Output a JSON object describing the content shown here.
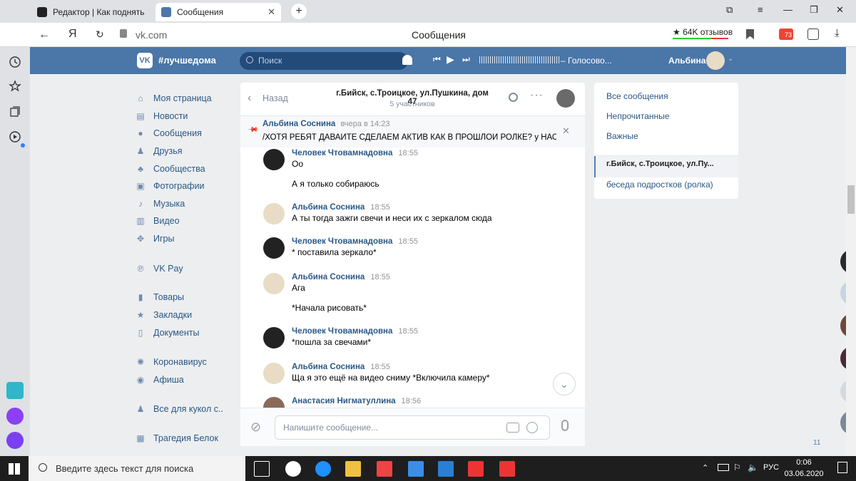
{
  "browser": {
    "tabs": [
      {
        "label": "Редактор | Как поднять ак"
      },
      {
        "label": "Сообщения"
      }
    ],
    "address": "vk.com",
    "page_title": "Сообщения",
    "reviews": "★ 64K отзывов",
    "badge": "73"
  },
  "vk": {
    "header": {
      "logo_text": "#лучшедома",
      "search_placeholder": "Поиск",
      "audio_title": "​– Голосово...",
      "user_name": "Альбина"
    },
    "left_nav": [
      {
        "label": "Моя страница",
        "icon": "home-icon"
      },
      {
        "label": "Новости",
        "icon": "news-icon"
      },
      {
        "label": "Сообщения",
        "icon": "messages-icon"
      },
      {
        "label": "Друзья",
        "icon": "friends-icon"
      },
      {
        "label": "Сообщества",
        "icon": "groups-icon"
      },
      {
        "label": "Фотографии",
        "icon": "photo-icon"
      },
      {
        "label": "Музыка",
        "icon": "music-icon"
      },
      {
        "label": "Видео",
        "icon": "video-icon"
      },
      {
        "label": "Игры",
        "icon": "games-icon"
      },
      {
        "label": "VK Pay",
        "icon": "vkpay-icon"
      },
      {
        "label": "Товары",
        "icon": "market-icon"
      },
      {
        "label": "Закладки",
        "icon": "bookmark-icon"
      },
      {
        "label": "Документы",
        "icon": "docs-icon"
      },
      {
        "label": "Коронавирус",
        "icon": "virus-icon"
      },
      {
        "label": "Афиша",
        "icon": "afisha-icon"
      },
      {
        "label": "Все для кукол с..",
        "icon": "group-icon"
      },
      {
        "label": "Трагедия Белок",
        "icon": "app-icon"
      }
    ],
    "chat": {
      "back_label": "Назад",
      "title": "г.Бийск, с.Троицкое, ул.Пушкина, дом 47",
      "participants": "5 участников",
      "pinned": {
        "author": "Альбина Соснина",
        "time": "вчера в 14:23",
        "text": "/ХОТЯ РЕБЯТ ДАВАЙТЕ СДЕЛАЕМ АКТИВ КАК В ПРОШЛОЙ РОЛКЕ? у НАС ..."
      },
      "messages": [
        {
          "author": "Человек Чтовамнадовна",
          "time": "18:55",
          "lines": [
            "Оо",
            "А я только собираюсь"
          ]
        },
        {
          "author": "Альбина Соснина",
          "time": "18:55",
          "lines": [
            "А ты тогда зажги свечи и неси их с зеркалом сюда"
          ]
        },
        {
          "author": "Человек Чтовамнадовна",
          "time": "18:55",
          "lines": [
            "* поставила зеркало*"
          ]
        },
        {
          "author": "Альбина Соснина",
          "time": "18:55",
          "lines": [
            "Ага",
            "*Начала рисовать*"
          ]
        },
        {
          "author": "Человек Чтовамнадовна",
          "time": "18:55",
          "lines": [
            "*пошла за свечами*"
          ]
        },
        {
          "author": "Альбина Соснина",
          "time": "18:55",
          "lines": [
            "Ща я это ещё на видео сниму *Включила камеру*"
          ]
        },
        {
          "author": "Анастасия Нигматуллина",
          "time": "18:56",
          "lines": []
        }
      ],
      "input_placeholder": "Напишите сообщение..."
    },
    "right_menu": [
      {
        "label": "Все сообщения"
      },
      {
        "label": "Непрочитанные"
      },
      {
        "label": "Важные"
      },
      {
        "label": "г.Бийск, с.Троицкое, ул.Пу..."
      },
      {
        "label": "беседа подростков (ролка)"
      }
    ],
    "online_count": "11"
  },
  "taskbar": {
    "search_placeholder": "Введите здесь текст для поиска",
    "lang": "РУС",
    "time": "0:06",
    "date": "03.06.2020"
  },
  "colors": {
    "vk_blue": "#4a76a8",
    "link": "#2a5885",
    "taskbar": "#1e1e1e"
  }
}
